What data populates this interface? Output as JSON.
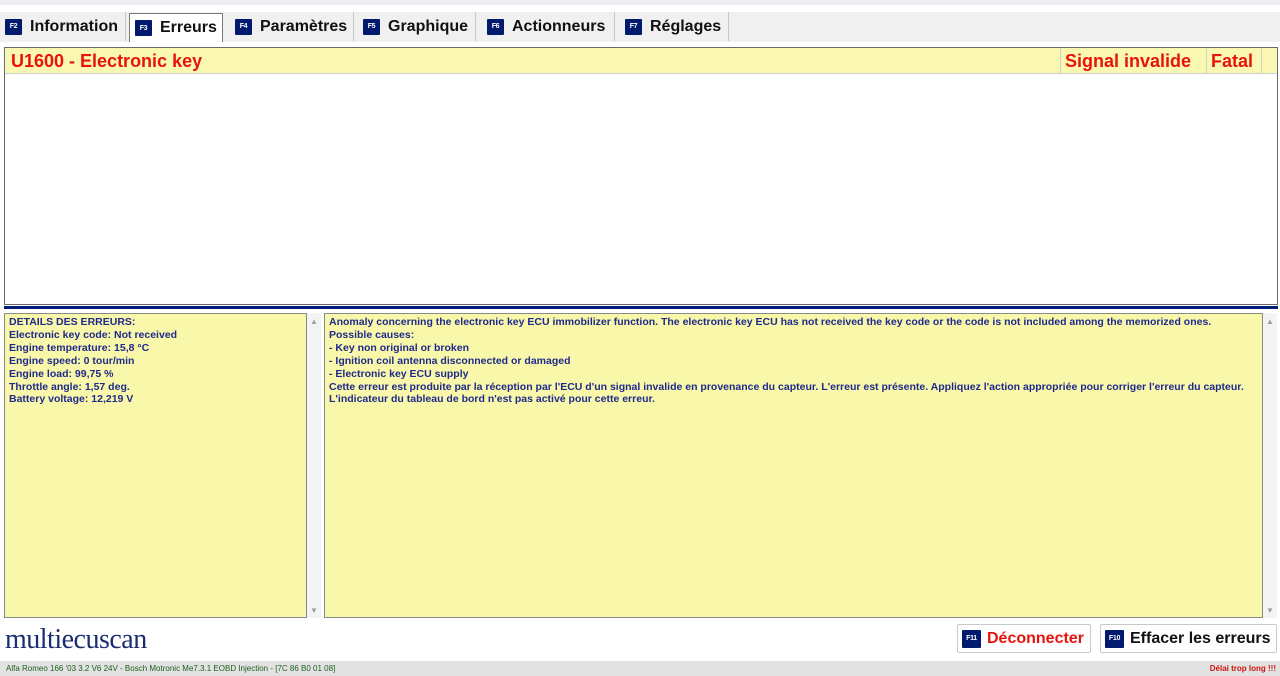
{
  "tabs": [
    {
      "key": "F2",
      "label": "Information"
    },
    {
      "key": "F3",
      "label": "Erreurs"
    },
    {
      "key": "F4",
      "label": "Paramètres"
    },
    {
      "key": "F5",
      "label": "Graphique"
    },
    {
      "key": "F6",
      "label": "Actionneurs"
    },
    {
      "key": "F7",
      "label": "Réglages"
    }
  ],
  "error": {
    "code_label": "U1600 - Electronic key",
    "signal": "Signal invalide",
    "severity": "Fatal"
  },
  "details": {
    "lines": [
      "DETAILS DES ERREURS:",
      "Electronic key code: Not received",
      "Engine temperature: 15,8 °C",
      "Engine speed: 0 tour/min",
      "Engine load: 99,75 %",
      "Throttle angle: 1,57 deg.",
      "Battery voltage: 12,219 V"
    ]
  },
  "description": {
    "lines": [
      "Anomaly concerning the electronic key ECU immobilizer function. The electronic key ECU has not received the key code or the code is not included among the memorized ones.",
      "Possible causes:",
      "- Key non original or broken",
      "- Ignition coil antenna disconnected or damaged",
      "- Electronic key ECU supply",
      "Cette erreur est produite par la réception par l'ECU d'un signal invalide en provenance du capteur. L'erreur est présente. Appliquez l'action appropriée pour corriger l'erreur du capteur. L'indicateur du tableau de bord n'est pas activé pour cette erreur."
    ]
  },
  "logo": "multiecuscan",
  "buttons": {
    "disconnect": {
      "key": "F11",
      "label": "Déconnecter"
    },
    "clear": {
      "key": "F10",
      "label": "Effacer les erreurs"
    }
  },
  "status": {
    "vehicle": "Alfa Romeo 166 '03 3.2 V6 24V - Bosch Motronic Me7.3.1 EOBD Injection - [7C 86 B0 01 08]",
    "message": "Délai trop long !!!"
  },
  "colors": {
    "error_text": "#e8140c",
    "panel_bg": "#f9f7a9",
    "fkey_bg": "#001a6e",
    "detail_text": "#1e2a8c"
  }
}
